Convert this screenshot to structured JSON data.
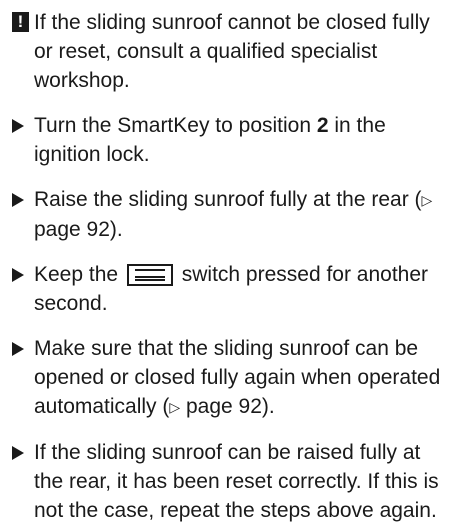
{
  "warning": {
    "icon": "exclamation-icon",
    "text": "If the sliding sunroof cannot be closed fully or reset, consult a qualified specialist workshop."
  },
  "steps": [
    {
      "before": "Turn the SmartKey to position ",
      "bold": "2",
      "after": " in the ignition lock."
    },
    {
      "text": "Raise the sliding sunroof fully at the rear (",
      "ref_icon": "▷",
      "ref": " page 92",
      "after": ")."
    },
    {
      "before": "Keep the ",
      "icon": "sunroof-switch-icon",
      "after": " switch pressed for another second."
    },
    {
      "text": "Make sure that the sliding sunroof can be opened or closed fully again when operated automatically (",
      "ref_icon": "▷",
      "ref": " page 92",
      "after": ")."
    },
    {
      "text": "If the sliding sunroof can be raised fully at the rear, it has been reset correctly. If this is not the case, repeat the steps above again."
    }
  ]
}
